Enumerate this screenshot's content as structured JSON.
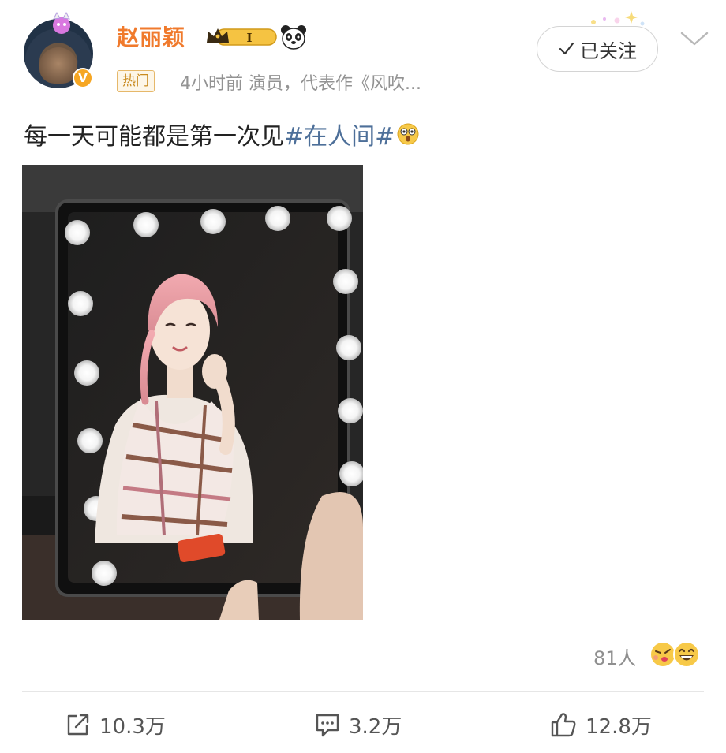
{
  "post": {
    "author": {
      "name": "赵丽颖",
      "vip_level": "I",
      "verified_mark": "V"
    },
    "badge": "热门",
    "meta": "4小时前  演员，代表作《风吹...",
    "follow_button": "已关注",
    "text_main": "每一天可能都是第一次见",
    "hashtag": "#在人间#",
    "reactions": {
      "count": "81人"
    },
    "actions": {
      "repost": "10.3万",
      "comment": "3.2万",
      "like": "12.8万"
    }
  },
  "colors": {
    "username": "#f07a2c",
    "hashtag": "#4d6f99",
    "badge_border": "#e6b86a",
    "verified": "#f6a623"
  },
  "icons": [
    "more-chevron-icon",
    "check-icon",
    "repost-icon",
    "comment-icon",
    "like-icon",
    "panda-icon",
    "vip-crown-icon"
  ]
}
